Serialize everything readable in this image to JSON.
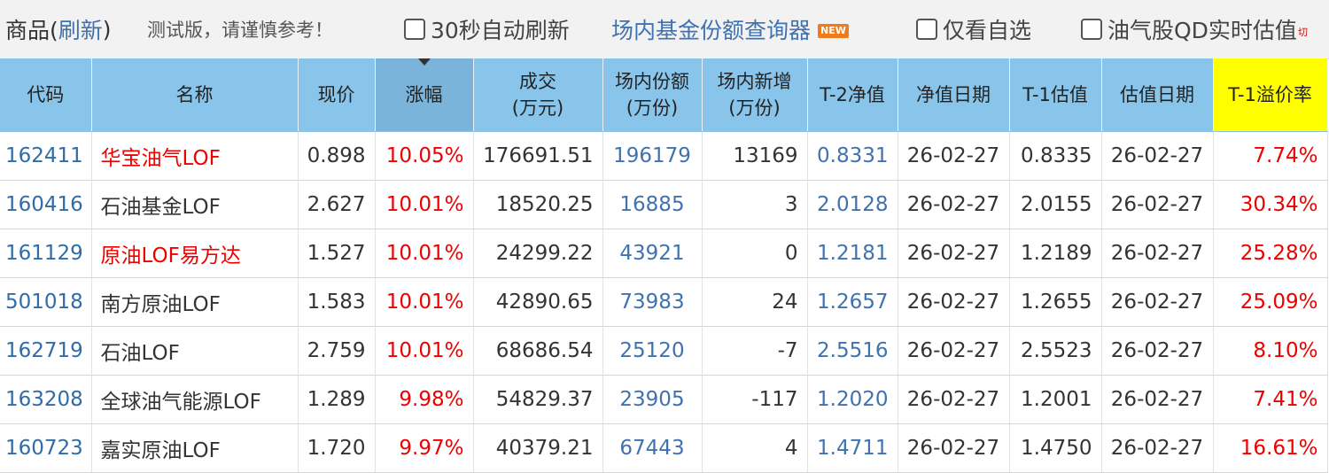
{
  "header": {
    "title_prefix": "商品(",
    "refresh_link": "刷新",
    "title_suffix": ")",
    "test_note": "测试版，请谨慎参考！",
    "auto_refresh_label": "30秒自动刷新",
    "query_link": "场内基金份额查询器",
    "new_badge": "NEW",
    "watch_only_label": "仅看自选",
    "oil_qd_label": "油气股QD实时估值",
    "oil_qd_cut": "切"
  },
  "table": {
    "sorted_column": "涨幅",
    "highlight_column": "T-1溢价率",
    "columns": [
      {
        "label1": "代码",
        "label2": ""
      },
      {
        "label1": "名称",
        "label2": ""
      },
      {
        "label1": "现价",
        "label2": ""
      },
      {
        "label1": "涨幅",
        "label2": ""
      },
      {
        "label1": "成交",
        "label2": "(万元)"
      },
      {
        "label1": "场内份额",
        "label2": "(万份)"
      },
      {
        "label1": "场内新增",
        "label2": "(万份)"
      },
      {
        "label1": "T-2净值",
        "label2": ""
      },
      {
        "label1": "净值日期",
        "label2": ""
      },
      {
        "label1": "T-1估值",
        "label2": ""
      },
      {
        "label1": "估值日期",
        "label2": ""
      },
      {
        "label1": "T-1溢价率",
        "label2": ""
      }
    ],
    "rows": [
      {
        "code": "162411",
        "name": "华宝油气LOF",
        "name_red": true,
        "price": "0.898",
        "change": "10.05%",
        "turnover": "176691.51",
        "shares": "196179",
        "new_shares": "13169",
        "nav_t2": "0.8331",
        "nav_date": "26-02-27",
        "est_t1": "0.8335",
        "est_date": "26-02-27",
        "premium": "7.74%"
      },
      {
        "code": "160416",
        "name": "石油基金LOF",
        "name_red": false,
        "price": "2.627",
        "change": "10.01%",
        "turnover": "18520.25",
        "shares": "16885",
        "new_shares": "3",
        "nav_t2": "2.0128",
        "nav_date": "26-02-27",
        "est_t1": "2.0155",
        "est_date": "26-02-27",
        "premium": "30.34%"
      },
      {
        "code": "161129",
        "name": "原油LOF易方达",
        "name_red": true,
        "price": "1.527",
        "change": "10.01%",
        "turnover": "24299.22",
        "shares": "43921",
        "new_shares": "0",
        "nav_t2": "1.2181",
        "nav_date": "26-02-27",
        "est_t1": "1.2189",
        "est_date": "26-02-27",
        "premium": "25.28%"
      },
      {
        "code": "501018",
        "name": "南方原油LOF",
        "name_red": false,
        "price": "1.583",
        "change": "10.01%",
        "turnover": "42890.65",
        "shares": "73983",
        "new_shares": "24",
        "nav_t2": "1.2657",
        "nav_date": "26-02-27",
        "est_t1": "1.2655",
        "est_date": "26-02-27",
        "premium": "25.09%"
      },
      {
        "code": "162719",
        "name": "石油LOF",
        "name_red": false,
        "price": "2.759",
        "change": "10.01%",
        "turnover": "68686.54",
        "shares": "25120",
        "new_shares": "-7",
        "nav_t2": "2.5516",
        "nav_date": "26-02-27",
        "est_t1": "2.5523",
        "est_date": "26-02-27",
        "premium": "8.10%"
      },
      {
        "code": "163208",
        "name": "全球油气能源LOF",
        "name_red": false,
        "price": "1.289",
        "change": "9.98%",
        "turnover": "54829.37",
        "shares": "23905",
        "new_shares": "-117",
        "nav_t2": "1.2020",
        "nav_date": "26-02-27",
        "est_t1": "1.2001",
        "est_date": "26-02-27",
        "premium": "7.41%"
      },
      {
        "code": "160723",
        "name": "嘉实原油LOF",
        "name_red": false,
        "price": "1.720",
        "change": "9.97%",
        "turnover": "40379.21",
        "shares": "67443",
        "new_shares": "4",
        "nav_t2": "1.4711",
        "nav_date": "26-02-27",
        "est_t1": "1.4750",
        "est_date": "26-02-27",
        "premium": "16.61%"
      }
    ]
  },
  "colors": {
    "header_bg": "#89c5ea",
    "sorted_header_bg": "#7bb4db",
    "highlight_header_bg": "#ffff00",
    "link_blue": "#3f72af",
    "up_red": "#ee0000"
  }
}
